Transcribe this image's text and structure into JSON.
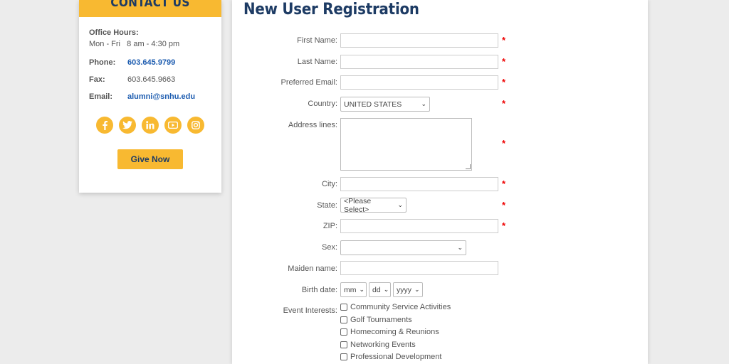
{
  "contact": {
    "header": "CONTACT US",
    "office_hours_label": "Office Hours:",
    "office_hours_value": "Mon - Fri   8 am - 4:30 pm",
    "phone_label": "Phone:",
    "phone_value": "603.645.9799",
    "fax_label": "Fax:",
    "fax_value": "603.645.9663",
    "email_label": "Email:",
    "email_value": "alumni@snhu.edu",
    "social_icons": [
      "facebook-icon",
      "twitter-icon",
      "linkedin-icon",
      "youtube-icon",
      "instagram-icon"
    ],
    "give_button": "Give Now"
  },
  "form": {
    "title": "New User Registration",
    "required_mark": "*",
    "labels": {
      "first_name": "First Name:",
      "last_name": "Last Name:",
      "preferred_email": "Preferred Email:",
      "country": "Country:",
      "address": "Address lines:",
      "city": "City:",
      "state": "State:",
      "zip": "ZIP:",
      "sex": "Sex:",
      "maiden_name": "Maiden name:",
      "birth_date": "Birth date:",
      "event_interests": "Event Interests:"
    },
    "country_selected": "UNITED STATES",
    "state_selected": "<Please Select>",
    "sex_selected": "",
    "birth_month": "mm",
    "birth_day": "dd",
    "birth_year": "yyyy",
    "event_options": [
      "Community Service Activities",
      "Golf Tournaments",
      "Homecoming & Reunions",
      "Networking Events",
      "Professional Development"
    ]
  },
  "colors": {
    "accent": "#f8b931",
    "brand_navy": "#1d3b64",
    "link_blue": "#1e5db0",
    "required_red": "#e00000"
  }
}
